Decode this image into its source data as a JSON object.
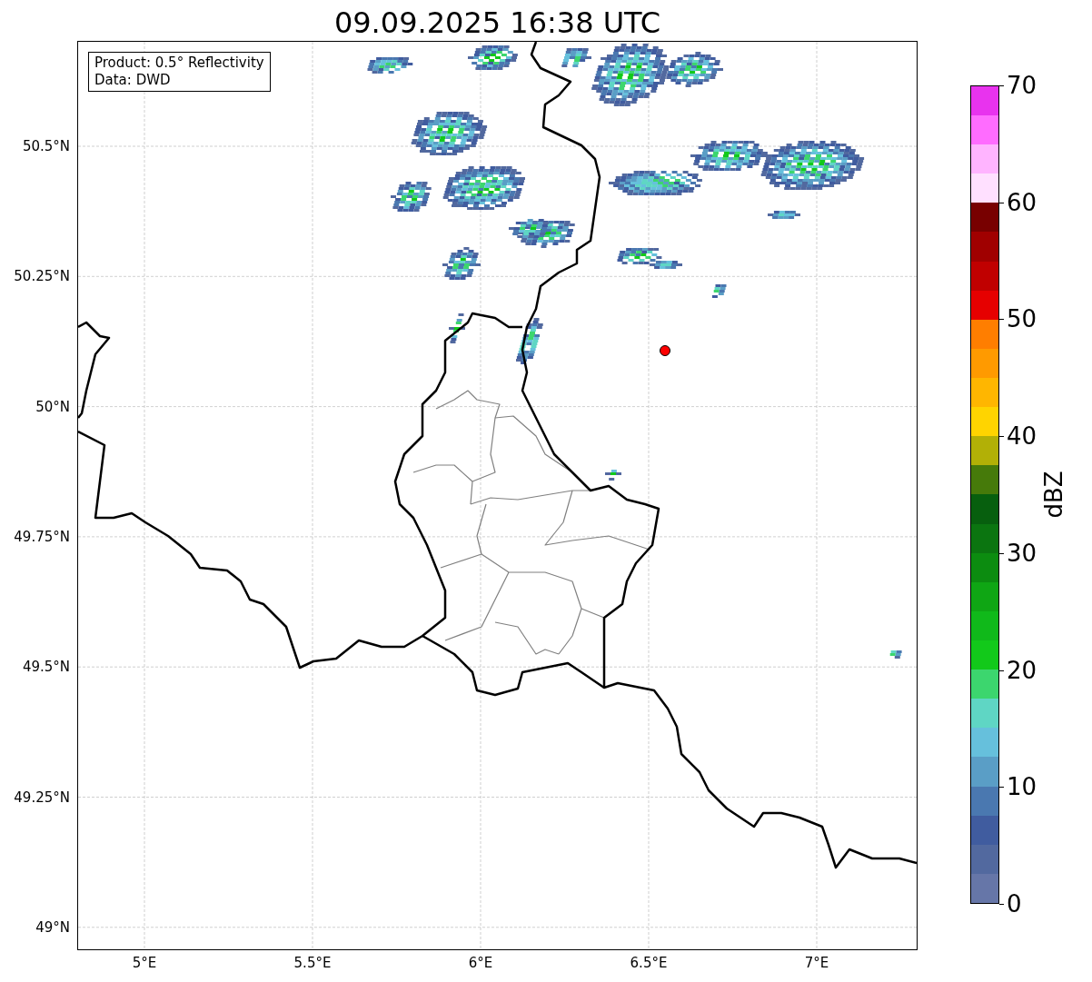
{
  "title": "09.09.2025 16:38 UTC",
  "info_box": [
    "Product: 0.5° Reflectivity",
    "Data: DWD"
  ],
  "map": {
    "lat_labels": [
      "50.5°N",
      "50.25°N",
      "50°N",
      "49.75°N",
      "49.5°N",
      "49.25°N",
      "49°N"
    ],
    "lon_labels": [
      "5°E",
      "5.5°E",
      "6°E",
      "6.5°E",
      "7°E"
    ]
  },
  "colorbar": {
    "label": "dBZ",
    "ticks": [
      "70",
      "60",
      "50",
      "40",
      "30",
      "20",
      "10",
      "0"
    ],
    "bands": [
      {
        "color": "#6676a8"
      },
      {
        "color": "#52699f"
      },
      {
        "color": "#405c9f"
      },
      {
        "color": "#4a78b0"
      },
      {
        "color": "#5a9ec6"
      },
      {
        "color": "#66c0dc"
      },
      {
        "color": "#5fd6c4"
      },
      {
        "color": "#3cd66e"
      },
      {
        "color": "#12c91a"
      },
      {
        "color": "#10b91a"
      },
      {
        "color": "#0fa614"
      },
      {
        "color": "#0c8c10"
      },
      {
        "color": "#0b7510"
      },
      {
        "color": "#075f0e"
      },
      {
        "color": "#467a0a"
      },
      {
        "color": "#b2b006"
      },
      {
        "color": "#ffd400"
      },
      {
        "color": "#ffb600"
      },
      {
        "color": "#ff9a00"
      },
      {
        "color": "#ff7e00"
      },
      {
        "color": "#e60000"
      },
      {
        "color": "#c00000"
      },
      {
        "color": "#a00000"
      },
      {
        "color": "#780000"
      },
      {
        "color": "#ffe0ff"
      },
      {
        "color": "#ffb4ff"
      },
      {
        "color": "#ff6cff"
      },
      {
        "color": "#e833ee"
      }
    ]
  }
}
